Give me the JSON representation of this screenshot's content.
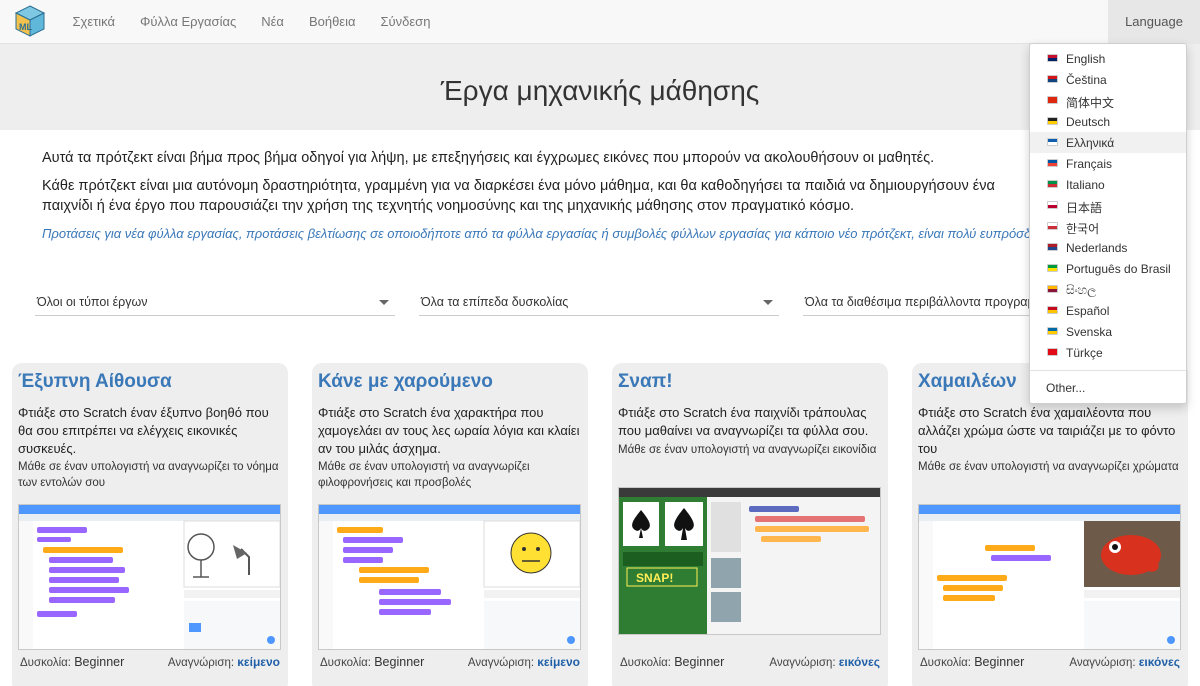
{
  "navbar": {
    "logo_letters": "ML",
    "links": [
      "Σχετικά",
      "Φύλλα Εργασίας",
      "Νέα",
      "Βοήθεια",
      "Σύνδεση"
    ],
    "language_button": "Language"
  },
  "hero": {
    "title": "Έργα μηχανικής μάθησης"
  },
  "intro": {
    "para1": "Αυτά τα πρότζεκτ είναι βήμα προς βήμα οδηγοί για λήψη, με επεξηγήσεις και έγχρωμες εικόνες που μπορούν να ακολουθήσουν οι μαθητές.",
    "para2": "Κάθε πρότζεκτ είναι μια αυτόνομη δραστηριότητα, γραμμένη για να διαρκέσει ένα μόνο μάθημα, και θα καθοδηγήσει τα παιδιά να δημιουργήσουν ένα παιχνίδι ή ένα έργο που παρουσιάζει την χρήση της τεχνητής νοημοσύνης και της μηχανικής μάθησης στον πραγματικό κόσμο.",
    "suggestions": "Προτάσεις για νέα φύλλα εργασίας, προτάσεις βελτίωσης σε οποιοδήποτε από τα φύλλα εργασίας ή συμβολές φύλλων εργασίας για κάποιο νέο πρότζεκτ, είναι πολύ ευπρόσδεκτες."
  },
  "filters": [
    "Όλοι οι τύποι έργων",
    "Όλα τα επίπεδα δυσκολίας",
    "Όλα τα διαθέσιμα περιβάλλοντα προγραμματισμού"
  ],
  "labels": {
    "difficulty": "Δυσκολία:",
    "recognition": "Αναγνώριση:"
  },
  "cards": [
    {
      "title": "Έξυπνη Αίθουσα",
      "description": "Φτιάξε στο Scratch έναν έξυπνο βοηθό που θα σου επιτρέπει να ελέγχεις εικονικές συσκευές.",
      "learn": "Μάθε σε έναν υπολογιστή να αναγνωρίζει το νόημα των εντολών σου",
      "difficulty": "Beginner",
      "recognition": "κείμενο",
      "image": "smart-classroom-screenshot"
    },
    {
      "title": "Κάνε με χαρούμενο",
      "description": "Φτιάξε στο Scratch ένα χαρακτήρα που χαμογελάει αν τους λες ωραία λόγια και κλαίει αν του μιλάς άσχημα.",
      "learn": "Μάθε σε έναν υπολογιστή να αναγνωρίζει φιλοφρονήσεις και προσβολές",
      "difficulty": "Beginner",
      "recognition": "κείμενο",
      "image": "make-me-happy-screenshot"
    },
    {
      "title": "Σναπ!",
      "description": "Φτιάξε στο Scratch ένα παιχνίδι τράπουλας που μαθαίνει να αναγνωρίζει τα φύλλα σου.",
      "learn": "Μάθε σε έναν υπολογιστή να αναγνωρίζει εικονίδια",
      "difficulty": "Beginner",
      "recognition": "εικόνες",
      "image": "snap-screenshot",
      "snap_banner": "SNAP!"
    },
    {
      "title": "Χαμαιλέων",
      "description": "Φτιάξε στο Scratch ένα χαμαιλέοντα που αλλάζει χρώμα ώστε να ταιριάζει με το φόντο του",
      "learn": "Μάθε σε έναν υπολογιστή να αναγνωρίζει χρώματα",
      "difficulty": "Beginner",
      "recognition": "εικόνες",
      "image": "chameleon-screenshot"
    }
  ],
  "language_menu": {
    "items": [
      {
        "label": "English",
        "flag": "uk-flag",
        "colors": [
          "#c8102e",
          "#012169"
        ]
      },
      {
        "label": "Čeština",
        "flag": "czech-flag",
        "colors": [
          "#d7141a",
          "#11457e"
        ]
      },
      {
        "label": "简体中文",
        "flag": "china-flag",
        "colors": [
          "#de2910",
          "#de2910"
        ]
      },
      {
        "label": "Deutsch",
        "flag": "germany-flag",
        "colors": [
          "#222222",
          "#ffce00"
        ]
      },
      {
        "label": "Ελληνικά",
        "flag": "greece-flag",
        "colors": [
          "#0d5eaf",
          "#ffffff"
        ],
        "active": true
      },
      {
        "label": "Français",
        "flag": "france-flag",
        "colors": [
          "#0055a4",
          "#ef4135"
        ]
      },
      {
        "label": "Italiano",
        "flag": "italy-flag",
        "colors": [
          "#009246",
          "#ce2b37"
        ]
      },
      {
        "label": "日本語",
        "flag": "japan-flag",
        "colors": [
          "#ffffff",
          "#bc002d"
        ]
      },
      {
        "label": "한국어",
        "flag": "korea-flag",
        "colors": [
          "#ffffff",
          "#cd2e3a"
        ]
      },
      {
        "label": "Nederlands",
        "flag": "netherlands-flag",
        "colors": [
          "#ae1c28",
          "#21468b"
        ]
      },
      {
        "label": "Português do Brasil",
        "flag": "brazil-flag",
        "colors": [
          "#009c3b",
          "#ffdf00"
        ]
      },
      {
        "label": "සිංහල",
        "flag": "sri-lanka-flag",
        "colors": [
          "#ffb700",
          "#8d153a"
        ]
      },
      {
        "label": "Español",
        "flag": "spain-flag",
        "colors": [
          "#c60b1e",
          "#ffc400"
        ]
      },
      {
        "label": "Svenska",
        "flag": "sweden-flag",
        "colors": [
          "#006aa7",
          "#fecc00"
        ]
      },
      {
        "label": "Türkçe",
        "flag": "turkey-flag",
        "colors": [
          "#e30a17",
          "#e30a17"
        ]
      }
    ],
    "other": "Other..."
  }
}
